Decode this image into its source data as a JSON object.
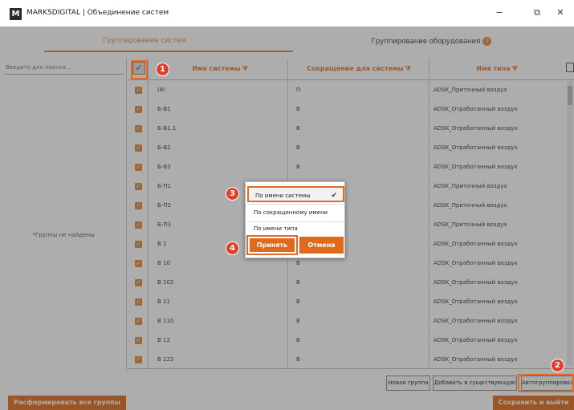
{
  "window": {
    "logo": "M",
    "title": "MARKSDIGITAL | Объединение систем",
    "minimize": "−",
    "restore": "⧉",
    "close": "✕"
  },
  "tabs": [
    {
      "label": "Группирование систем",
      "active": true
    },
    {
      "label": "Группирование оборудования",
      "active": false
    }
  ],
  "help_icon": "?",
  "left_panel": {
    "search_placeholder": "Введите для поиска...",
    "empty_message": "*Группы не найдены"
  },
  "table": {
    "columns": [
      "Имя системы",
      "Сокращение для системы",
      "Имя типа"
    ],
    "filter_icon": "filter-icon",
    "rows": [
      {
        "name": "(8)",
        "abbr": "П",
        "type": "ADSK_Приточный воздух"
      },
      {
        "name": "Б-В1",
        "abbr": "В",
        "type": "ADSK_Отработанный воздух"
      },
      {
        "name": "Б-В1.1",
        "abbr": "В",
        "type": "ADSK_Отработанный воздух"
      },
      {
        "name": "Б-В2",
        "abbr": "В",
        "type": "ADSK_Отработанный воздух"
      },
      {
        "name": "Б-В3",
        "abbr": "В",
        "type": "ADSK_Отработанный воздух"
      },
      {
        "name": "Б-П1",
        "abbr": "",
        "type": "ADSK_Приточный воздух"
      },
      {
        "name": "Б-П2",
        "abbr": "",
        "type": "ADSK_Приточный воздух"
      },
      {
        "name": "Б-П3",
        "abbr": "",
        "type": "ADSK_Приточный воздух"
      },
      {
        "name": "В 1",
        "abbr": "",
        "type": "ADSK_Отработанный воздух"
      },
      {
        "name": "В 10",
        "abbr": "В",
        "type": "ADSK_Отработанный воздух"
      },
      {
        "name": "В 102",
        "abbr": "В",
        "type": "ADSK_Отработанный воздух"
      },
      {
        "name": "В 11",
        "abbr": "В",
        "type": "ADSK_Отработанный воздух"
      },
      {
        "name": "В 110",
        "abbr": "В",
        "type": "ADSK_Отработанный воздух"
      },
      {
        "name": "В 12",
        "abbr": "В",
        "type": "ADSK_Отработанный воздух"
      },
      {
        "name": "В 123",
        "abbr": "В",
        "type": "ADSK_Отработанный воздух"
      }
    ]
  },
  "buttons": {
    "new_group": "Новая группа",
    "add_existing": "Добавить в существующую",
    "autogroup": "Автогруппировка",
    "disband_all": "Расформировать все группы",
    "save_exit": "Сохранить и выйти"
  },
  "sort_popup": {
    "options": [
      "По имени системы",
      "По сокращенному имени",
      "По имени типа"
    ],
    "selected_index": 0,
    "accept": "Принять",
    "cancel": "Отмена"
  },
  "badges": [
    "1",
    "2",
    "3",
    "4"
  ],
  "colors": {
    "accent": "#e0883a",
    "badge": "#e0402a",
    "button": "#e06a1a"
  }
}
